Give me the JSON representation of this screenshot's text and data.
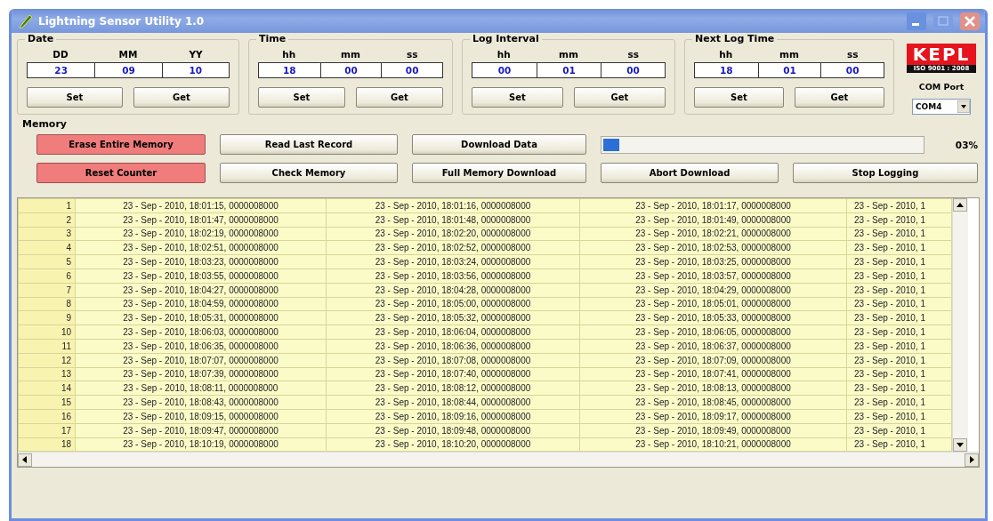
{
  "window": {
    "title": "Lightning Sensor Utility 1.0"
  },
  "groups": [
    {
      "title": "Date",
      "fields": [
        {
          "label": "DD",
          "value": "23"
        },
        {
          "label": "MM",
          "value": "09"
        },
        {
          "label": "YY",
          "value": "10"
        }
      ],
      "buttons": [
        "Set",
        "Get"
      ]
    },
    {
      "title": "Time",
      "fields": [
        {
          "label": "hh",
          "value": "18"
        },
        {
          "label": "mm",
          "value": "00"
        },
        {
          "label": "ss",
          "value": "00"
        }
      ],
      "buttons": [
        "Set",
        "Get"
      ]
    },
    {
      "title": "Log Interval",
      "fields": [
        {
          "label": "hh",
          "value": "00"
        },
        {
          "label": "mm",
          "value": "01"
        },
        {
          "label": "ss",
          "value": "00"
        }
      ],
      "buttons": [
        "Set",
        "Get"
      ]
    },
    {
      "title": "Next Log Time",
      "fields": [
        {
          "label": "hh",
          "value": "18"
        },
        {
          "label": "mm",
          "value": "01"
        },
        {
          "label": "ss",
          "value": "00"
        }
      ],
      "buttons": [
        "Set",
        "Get"
      ]
    }
  ],
  "logo": {
    "text": "KEPL",
    "caption": "ISO 9001 : 2008"
  },
  "com_port": {
    "label": "COM Port",
    "value": "COM4"
  },
  "memory": {
    "title": "Memory",
    "buttons": [
      {
        "label": "Erase Entire Memory",
        "kind": "danger"
      },
      {
        "label": "Read Last Record",
        "kind": "normal"
      },
      {
        "label": "Download Data",
        "kind": "normal"
      },
      {
        "label": "Reset Counter",
        "kind": "danger"
      },
      {
        "label": "Check Memory",
        "kind": "normal"
      },
      {
        "label": "Full Memory Download",
        "kind": "normal"
      },
      {
        "label": "Abort Download",
        "kind": "normal"
      },
      {
        "label": "Stop Logging",
        "kind": "normal"
      }
    ],
    "progress": {
      "level": 0.06,
      "reading": "03%"
    }
  },
  "table": {
    "rows": [
      {
        "number": "1",
        "cells": [
          "23 - Sep - 2010, 18:01:15, 0000008000",
          "23 - Sep - 2010, 18:01:16, 0000008000",
          "23 - Sep - 2010, 18:01:17, 0000008000",
          "23 - Sep - 2010, 1"
        ]
      },
      {
        "number": "2",
        "cells": [
          "23 - Sep - 2010, 18:01:47, 0000008000",
          "23 - Sep - 2010, 18:01:48, 0000008000",
          "23 - Sep - 2010, 18:01:49, 0000008000",
          "23 - Sep - 2010, 1"
        ]
      },
      {
        "number": "3",
        "cells": [
          "23 - Sep - 2010, 18:02:19, 0000008000",
          "23 - Sep - 2010, 18:02:20, 0000008000",
          "23 - Sep - 2010, 18:02:21, 0000008000",
          "23 - Sep - 2010, 1"
        ]
      },
      {
        "number": "4",
        "cells": [
          "23 - Sep - 2010, 18:02:51, 0000008000",
          "23 - Sep - 2010, 18:02:52, 0000008000",
          "23 - Sep - 2010, 18:02:53, 0000008000",
          "23 - Sep - 2010, 1"
        ]
      },
      {
        "number": "5",
        "cells": [
          "23 - Sep - 2010, 18:03:23, 0000008000",
          "23 - Sep - 2010, 18:03:24, 0000008000",
          "23 - Sep - 2010, 18:03:25, 0000008000",
          "23 - Sep - 2010, 1"
        ]
      },
      {
        "number": "6",
        "cells": [
          "23 - Sep - 2010, 18:03:55, 0000008000",
          "23 - Sep - 2010, 18:03:56, 0000008000",
          "23 - Sep - 2010, 18:03:57, 0000008000",
          "23 - Sep - 2010, 1"
        ]
      },
      {
        "number": "7",
        "cells": [
          "23 - Sep - 2010, 18:04:27, 0000008000",
          "23 - Sep - 2010, 18:04:28, 0000008000",
          "23 - Sep - 2010, 18:04:29, 0000008000",
          "23 - Sep - 2010, 1"
        ]
      },
      {
        "number": "8",
        "cells": [
          "23 - Sep - 2010, 18:04:59, 0000008000",
          "23 - Sep - 2010, 18:05:00, 0000008000",
          "23 - Sep - 2010, 18:05:01, 0000008000",
          "23 - Sep - 2010, 1"
        ]
      },
      {
        "number": "9",
        "cells": [
          "23 - Sep - 2010, 18:05:31, 0000008000",
          "23 - Sep - 2010, 18:05:32, 0000008000",
          "23 - Sep - 2010, 18:05:33, 0000008000",
          "23 - Sep - 2010, 1"
        ]
      },
      {
        "number": "10",
        "cells": [
          "23 - Sep - 2010, 18:06:03, 0000008000",
          "23 - Sep - 2010, 18:06:04, 0000008000",
          "23 - Sep - 2010, 18:06:05, 0000008000",
          "23 - Sep - 2010, 1"
        ]
      },
      {
        "number": "11",
        "cells": [
          "23 - Sep - 2010, 18:06:35, 0000008000",
          "23 - Sep - 2010, 18:06:36, 0000008000",
          "23 - Sep - 2010, 18:06:37, 0000008000",
          "23 - Sep - 2010, 1"
        ]
      },
      {
        "number": "12",
        "cells": [
          "23 - Sep - 2010, 18:07:07, 0000008000",
          "23 - Sep - 2010, 18:07:08, 0000008000",
          "23 - Sep - 2010, 18:07:09, 0000008000",
          "23 - Sep - 2010, 1"
        ]
      },
      {
        "number": "13",
        "cells": [
          "23 - Sep - 2010, 18:07:39, 0000008000",
          "23 - Sep - 2010, 18:07:40, 0000008000",
          "23 - Sep - 2010, 18:07:41, 0000008000",
          "23 - Sep - 2010, 1"
        ]
      },
      {
        "number": "14",
        "cells": [
          "23 - Sep - 2010, 18:08:11, 0000008000",
          "23 - Sep - 2010, 18:08:12, 0000008000",
          "23 - Sep - 2010, 18:08:13, 0000008000",
          "23 - Sep - 2010, 1"
        ]
      },
      {
        "number": "15",
        "cells": [
          "23 - Sep - 2010, 18:08:43, 0000008000",
          "23 - Sep - 2010, 18:08:44, 0000008000",
          "23 - Sep - 2010, 18:08:45, 0000008000",
          "23 - Sep - 2010, 1"
        ]
      },
      {
        "number": "16",
        "cells": [
          "23 - Sep - 2010, 18:09:15, 0000008000",
          "23 - Sep - 2010, 18:09:16, 0000008000",
          "23 - Sep - 2010, 18:09:17, 0000008000",
          "23 - Sep - 2010, 1"
        ]
      },
      {
        "number": "17",
        "cells": [
          "23 - Sep - 2010, 18:09:47, 0000008000",
          "23 - Sep - 2010, 18:09:48, 0000008000",
          "23 - Sep - 2010, 18:09:49, 0000008000",
          "23 - Sep - 2010, 1"
        ]
      },
      {
        "number": "18",
        "cells": [
          "23 - Sep - 2010, 18:10:19, 0000008000",
          "23 - Sep - 2010, 18:10:20, 0000008000",
          "23 - Sep - 2010, 18:10:21, 0000008000",
          "23 - Sep - 2010, 1"
        ]
      }
    ]
  }
}
